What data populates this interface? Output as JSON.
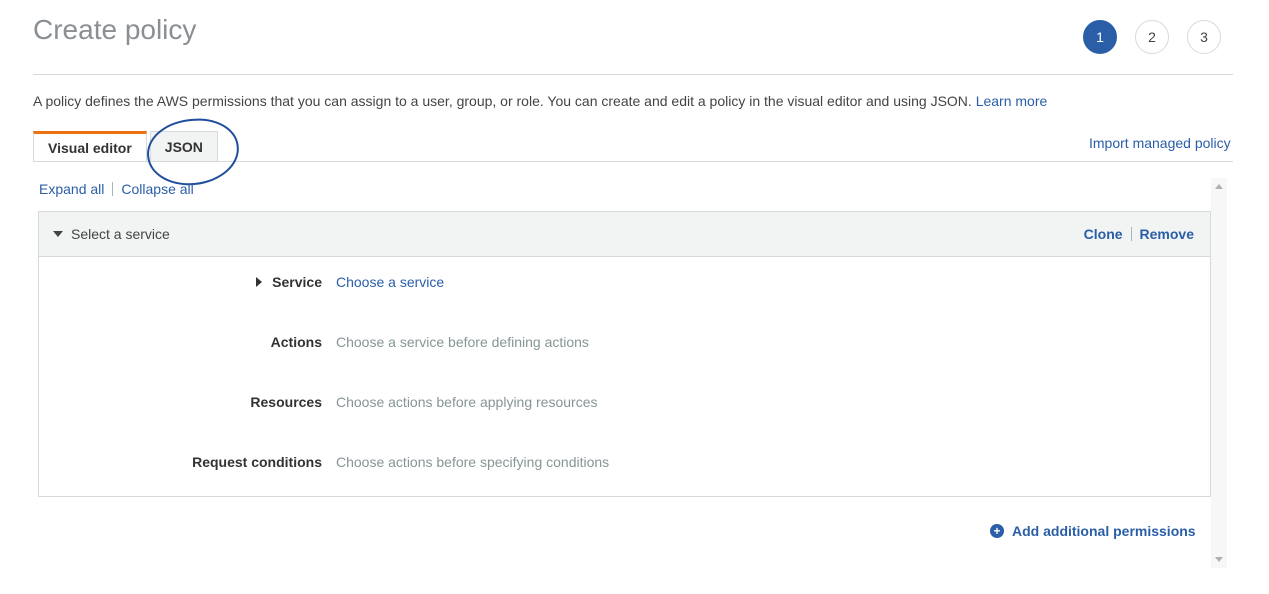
{
  "page": {
    "title": "Create policy",
    "steps": [
      "1",
      "2",
      "3"
    ],
    "active_step": "1"
  },
  "intro": {
    "description": "A policy defines the AWS permissions that you can assign to a user, group, or role. You can create and edit a policy in the visual editor and using JSON.",
    "learn_more": "Learn more"
  },
  "tabs": [
    {
      "label": "Visual editor",
      "active": true
    },
    {
      "label": "JSON",
      "active": false
    }
  ],
  "import_link": "Import managed policy",
  "expand_all": "Expand all",
  "collapse_all": "Collapse all",
  "panel": {
    "header": "Select a service",
    "clone": "Clone",
    "remove": "Remove",
    "fields": [
      {
        "label": "Service",
        "value": "Choose a service"
      },
      {
        "label": "Actions",
        "value": "Choose a service before defining actions"
      },
      {
        "label": "Resources",
        "value": "Choose actions before applying resources"
      },
      {
        "label": "Request conditions",
        "value": "Choose actions before specifying conditions"
      }
    ]
  },
  "add_permissions": "Add additional permissions",
  "colors": {
    "accent": "#2a5ea7",
    "active_tab": "#ec7211",
    "annotation": "#1f4e9c"
  },
  "icons": {
    "add": "plus-circle-icon",
    "panel_toggle": "caret-down-icon",
    "service_toggle": "caret-right-icon"
  }
}
